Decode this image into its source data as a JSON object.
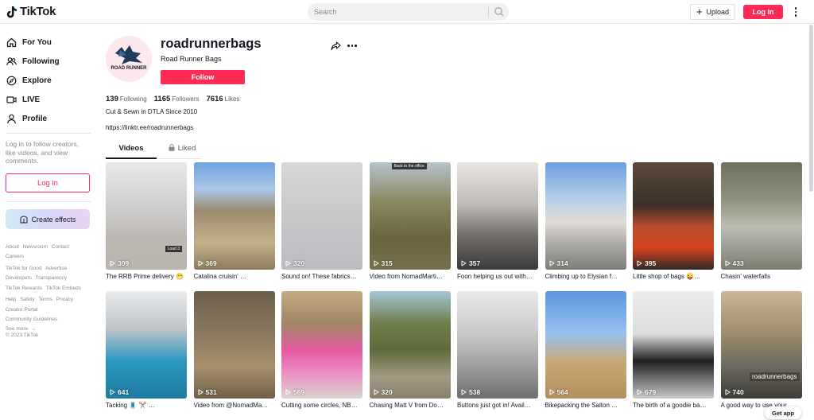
{
  "header": {
    "logo_text": "TikTok",
    "search_placeholder": "Search",
    "upload_label": "Upload",
    "login_label": "Log in",
    "accent": "#fe2c55"
  },
  "sidebar": {
    "items": [
      {
        "label": "For You",
        "icon": "home-icon"
      },
      {
        "label": "Following",
        "icon": "users-icon"
      },
      {
        "label": "Explore",
        "icon": "compass-icon"
      },
      {
        "label": "LIVE",
        "icon": "live-icon"
      },
      {
        "label": "Profile",
        "icon": "user-icon"
      }
    ],
    "login_note": "Log in to follow creators, like videos, and view comments.",
    "login_button": "Log in",
    "effects_label": "Create effects",
    "footer_groups": [
      [
        "About",
        "Newsroom",
        "Contact",
        "Careers"
      ],
      [
        "TikTok for Good",
        "Advertise",
        "Developers",
        "Transparency",
        "TikTok Rewards",
        "TikTok Embeds"
      ],
      [
        "Help",
        "Safety",
        "Terms",
        "Privacy",
        "Creator Portal",
        "Community Guidelines"
      ]
    ],
    "see_more": "See more",
    "copyright": "© 2023 TikTok"
  },
  "profile": {
    "username": "roadrunnerbags",
    "display_name": "Road Runner Bags",
    "follow_label": "Follow",
    "following_count": "139",
    "following_label": "Following",
    "followers_count": "1165",
    "followers_label": "Followers",
    "likes_count": "7616",
    "likes_label": "Likes",
    "bio": "Cut & Sewn in DTLA Since 2010",
    "link": "https://linktr.ee/roadrunnerbags",
    "avatar_text": "ROAD RUNNER"
  },
  "tabs": [
    {
      "label": "Videos",
      "active": true
    },
    {
      "label": "Liked",
      "active": false
    }
  ],
  "videos": [
    {
      "views": "309",
      "caption": "The RRB Prime delivery 😁",
      "overlay": "Load 3"
    },
    {
      "views": "369",
      "caption": "Catalina cruisin' …"
    },
    {
      "views": "320",
      "caption": "Sound on! These fabrics…"
    },
    {
      "views": "315",
      "caption": "Video from NomadMarti…",
      "overlay": "Back to the office"
    },
    {
      "views": "357",
      "caption": "Foon helping us out with…"
    },
    {
      "views": "314",
      "caption": "Climbing up to Elysian f…"
    },
    {
      "views": "395",
      "caption": "Little shop of bags 😜…"
    },
    {
      "views": "433",
      "caption": "Chasin' waterfalls"
    },
    {
      "views": "641",
      "caption": "Tacking 🧵 ✂️ …"
    },
    {
      "views": "531",
      "caption": "Video from @NomadMa…"
    },
    {
      "views": "569",
      "caption": "Cutting some circles, NB…"
    },
    {
      "views": "320",
      "caption": "Chasing Matt V from Do…"
    },
    {
      "views": "538",
      "caption": "Buttons just got in! Avail…"
    },
    {
      "views": "564",
      "caption": "Bikepacking the Salton …"
    },
    {
      "views": "679",
      "caption": "The birth of a goodie ba…"
    },
    {
      "views": "740",
      "caption": "A good way to use your…",
      "overlay": "roadrunnerbags"
    }
  ],
  "get_app": "Get app"
}
